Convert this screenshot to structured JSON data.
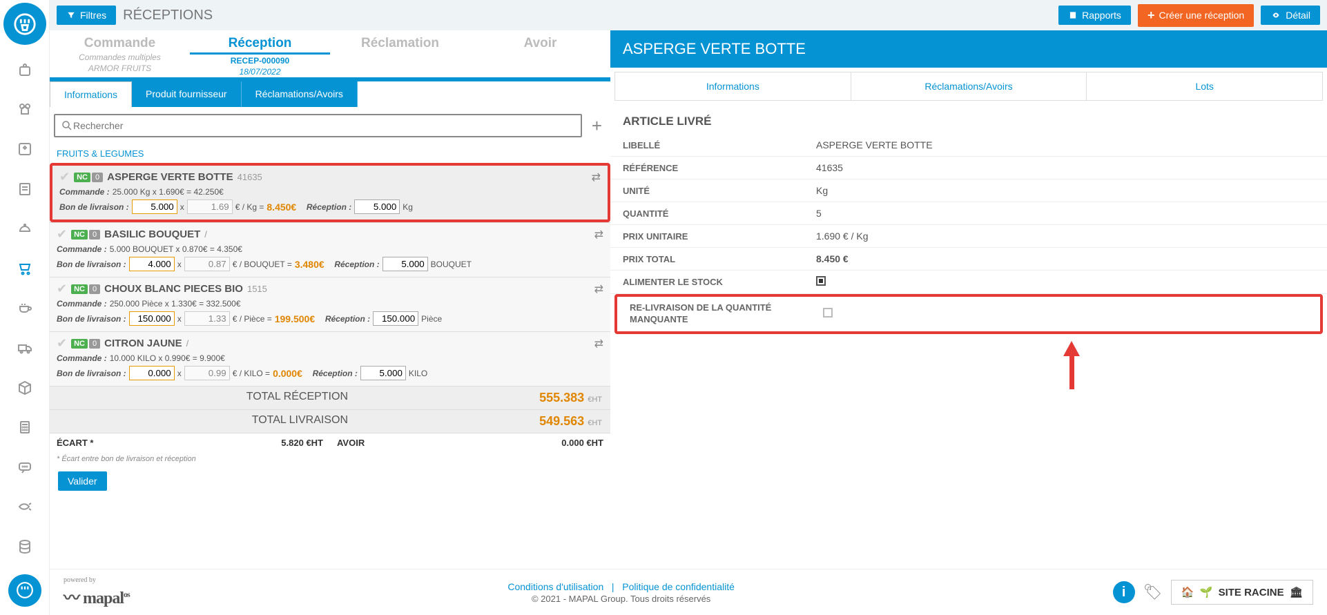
{
  "header": {
    "filters_label": "Filtres",
    "page_title": "RÉCEPTIONS",
    "reports_label": "Rapports",
    "create_label": "Créer une réception",
    "detail_label": "Détail"
  },
  "process_tabs": {
    "order": {
      "title": "Commande",
      "sub1": "Commandes multiples",
      "sub2": "ARMOR FRUITS"
    },
    "reception": {
      "title": "Réception",
      "ref": "RECEP-000090",
      "date": "18/07/2022"
    },
    "claim": {
      "title": "Réclamation"
    },
    "credit": {
      "title": "Avoir"
    }
  },
  "subtabs": {
    "info": "Informations",
    "supplier": "Produit fournisseur",
    "claims": "Réclamations/Avoirs"
  },
  "search": {
    "placeholder": "Rechercher"
  },
  "category": "FRUITS & LEGUMES",
  "items": [
    {
      "name": "ASPERGE VERTE BOTTE",
      "code": "41635",
      "cmd_label": "Commande :",
      "cmd_text": "25.000 Kg x  1.690€  =  42.250€",
      "bdl_label": "Bon de livraison :",
      "qty": "5.000",
      "x": "x",
      "price": "1.69",
      "unit_text": "€ / Kg =",
      "total": "8.450€",
      "rec_label": "Réception :",
      "rec_qty": "5.000",
      "rec_unit": "Kg"
    },
    {
      "name": "BASILIC BOUQUET",
      "code": "/",
      "cmd_label": "Commande :",
      "cmd_text": "5.000 BOUQUET x  0.870€  =  4.350€",
      "bdl_label": "Bon de livraison :",
      "qty": "4.000",
      "x": "x",
      "price": "0.87",
      "unit_text": "€ / BOUQUET =",
      "total": "3.480€",
      "rec_label": "Réception :",
      "rec_qty": "5.000",
      "rec_unit": "BOUQUET"
    },
    {
      "name": "CHOUX BLANC PIECES BIO",
      "code": "1515",
      "cmd_label": "Commande :",
      "cmd_text": "250.000 Pièce x  1.330€  =  332.500€",
      "bdl_label": "Bon de livraison :",
      "qty": "150.000",
      "x": "x",
      "price": "1.33",
      "unit_text": "€ / Pièce =",
      "total": "199.500€",
      "rec_label": "Réception :",
      "rec_qty": "150.000",
      "rec_unit": "Pièce"
    },
    {
      "name": "CITRON JAUNE",
      "code": "/",
      "cmd_label": "Commande :",
      "cmd_text": "10.000 KILO x  0.990€  =  9.900€",
      "bdl_label": "Bon de livraison :",
      "qty": "0.000",
      "x": "x",
      "price": "0.99",
      "unit_text": "€ / KILO =",
      "total": "0.000€",
      "rec_label": "Réception :",
      "rec_qty": "5.000",
      "rec_unit": "KILO"
    }
  ],
  "totals": {
    "reception_label": "TOTAL RÉCEPTION",
    "reception_val": "555.383",
    "delivery_label": "TOTAL LIVRAISON",
    "delivery_val": "549.563",
    "ecart_label": "ÉCART *",
    "ecart_val": "5.820 €HT",
    "avoir_label": "AVOIR",
    "avoir_val": "0.000 €HT",
    "eht": "€HT",
    "note": "* Écart entre bon de livraison et réception",
    "validate": "Valider"
  },
  "right": {
    "title": "ASPERGE VERTE BOTTE",
    "tabs": {
      "info": "Informations",
      "claims": "Réclamations/Avoirs",
      "lots": "Lots"
    },
    "section_title": "ARTICLE LIVRÉ",
    "fields": {
      "libelle_k": "LIBELLÉ",
      "libelle_v": "ASPERGE VERTE BOTTE",
      "ref_k": "RÉFÉRENCE",
      "ref_v": "41635",
      "unite_k": "UNITÉ",
      "unite_v": "Kg",
      "qte_k": "QUANTITÉ",
      "qte_v": "5",
      "pu_k": "PRIX UNITAIRE",
      "pu_v": "1.690 € / Kg",
      "pt_k": "PRIX TOTAL",
      "pt_v": "8.450 €",
      "stock_k": "ALIMENTER LE STOCK",
      "reliv_k": "RE-LIVRAISON DE LA QUANTITÉ MANQUANTE"
    }
  },
  "footer": {
    "powered": "powered by",
    "brand": "mapal",
    "brand_suffix": "os",
    "terms": "Conditions d'utilisation",
    "sep": "|",
    "privacy": "Politique de confidentialité",
    "copyright": "© 2021 - MAPAL Group. Tous droits réservés",
    "site": "SITE RACINE"
  }
}
